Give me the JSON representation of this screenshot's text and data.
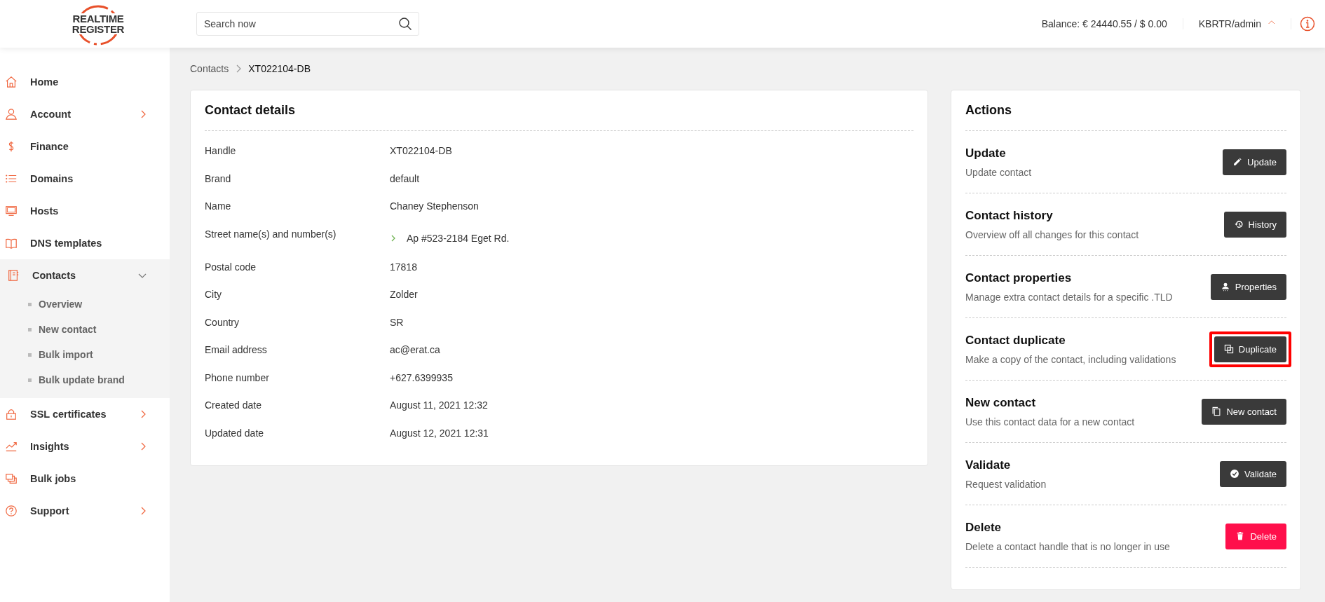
{
  "logo": {
    "lines": [
      "REALTIME",
      "REGISTER"
    ]
  },
  "search": {
    "placeholder": "Search now"
  },
  "header": {
    "balance": "Balance: € 24440.55 / $ 0.00",
    "user": "KBRTR/admin"
  },
  "sidebar": {
    "items": [
      {
        "label": "Home",
        "has_submenu": false,
        "expanded": false
      },
      {
        "label": "Account",
        "has_submenu": true,
        "expanded": false
      },
      {
        "label": "Finance",
        "has_submenu": false,
        "expanded": false
      },
      {
        "label": "Domains",
        "has_submenu": false,
        "expanded": false
      },
      {
        "label": "Hosts",
        "has_submenu": false,
        "expanded": false
      },
      {
        "label": "DNS templates",
        "has_submenu": false,
        "expanded": false
      },
      {
        "label": "Contacts",
        "has_submenu": true,
        "expanded": true,
        "children": [
          {
            "label": "Overview"
          },
          {
            "label": "New contact"
          },
          {
            "label": "Bulk import"
          },
          {
            "label": "Bulk update brand"
          }
        ]
      },
      {
        "label": "SSL certificates",
        "has_submenu": true,
        "expanded": false
      },
      {
        "label": "Insights",
        "has_submenu": true,
        "expanded": false
      },
      {
        "label": "Bulk jobs",
        "has_submenu": false,
        "expanded": false
      },
      {
        "label": "Support",
        "has_submenu": true,
        "expanded": false
      }
    ]
  },
  "breadcrumb": [
    "Contacts",
    "XT022104-DB"
  ],
  "details": {
    "title": "Contact details",
    "rows": [
      {
        "label": "Handle",
        "value": "XT022104-DB"
      },
      {
        "label": "Brand",
        "value": "default"
      },
      {
        "label": "Name",
        "value": "Chaney Stephenson"
      },
      {
        "label": "Street name(s) and number(s)",
        "value": "Ap #523-2184 Eget Rd.",
        "expandable": true
      },
      {
        "label": "Postal code",
        "value": "17818"
      },
      {
        "label": "City",
        "value": "Zolder"
      },
      {
        "label": "Country",
        "value": "SR"
      },
      {
        "label": "Email address",
        "value": "ac@erat.ca"
      },
      {
        "label": "Phone number",
        "value": "+627.6399935"
      },
      {
        "label": "Created date",
        "value": "August 11, 2021 12:32"
      },
      {
        "label": "Updated date",
        "value": "August 12, 2021 12:31"
      }
    ]
  },
  "actions": {
    "title": "Actions",
    "items": [
      {
        "title": "Update",
        "description": "Update contact",
        "button": "Update",
        "kind": "dark",
        "highlighted": false
      },
      {
        "title": "Contact history",
        "description": "Overview off all changes for this contact",
        "button": "History",
        "kind": "dark",
        "highlighted": false
      },
      {
        "title": "Contact properties",
        "description": "Manage extra contact details for a specific .TLD",
        "button": "Properties",
        "kind": "dark",
        "highlighted": false
      },
      {
        "title": "Contact duplicate",
        "description": "Make a copy of the contact, including validations",
        "button": "Duplicate",
        "kind": "dark",
        "highlighted": true
      },
      {
        "title": "New contact",
        "description": "Use this contact data for a new contact",
        "button": "New contact",
        "kind": "dark",
        "highlighted": false
      },
      {
        "title": "Validate",
        "description": "Request validation",
        "button": "Validate",
        "kind": "dark",
        "highlighted": false
      },
      {
        "title": "Delete",
        "description": "Delete a contact handle that is no longer in use",
        "button": "Delete",
        "kind": "danger",
        "highlighted": false
      }
    ]
  }
}
